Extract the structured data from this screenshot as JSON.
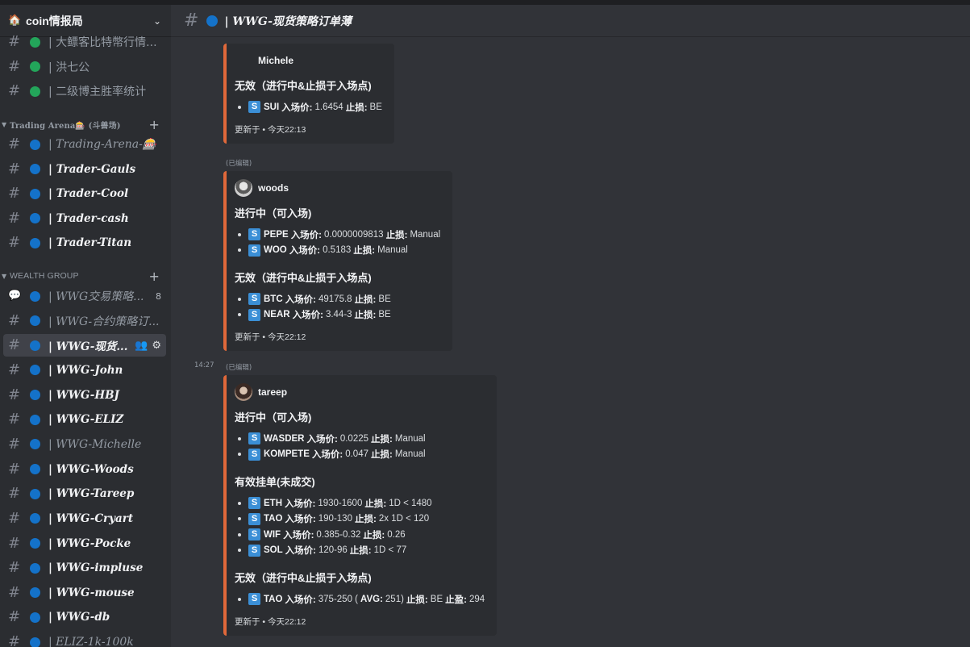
{
  "server": {
    "icon": "house-emoji-icon",
    "name": "coin情报局"
  },
  "top_channels": [
    {
      "name": "| 大鳔客比特幣行情...",
      "dot": "green"
    },
    {
      "name": "| 洪七公",
      "dot": "green"
    },
    {
      "name": "| 二级博主胜率统计",
      "dot": "green"
    }
  ],
  "category_trading": "Trading Arena🎰 (斗兽场)",
  "trading_channels": [
    {
      "name": "| Trading-Arena-🎰",
      "dot": "blue",
      "style": "serif"
    },
    {
      "name": "| Trader-Gauls",
      "dot": "blue",
      "style": "bold"
    },
    {
      "name": "| Trader-Cool",
      "dot": "blue",
      "style": "bold"
    },
    {
      "name": "| Trader-cash",
      "dot": "blue",
      "style": "bold"
    },
    {
      "name": "| Trader-Titan",
      "dot": "blue",
      "style": "bold"
    }
  ],
  "category_wealth": "WEALTH GROUP",
  "wealth_channels": [
    {
      "name": "| WWG交易策略...",
      "dot": "blue",
      "style": "serif",
      "badge": "8",
      "icon": "forum-icon"
    },
    {
      "name": "| WWG-合约策略订...",
      "dot": "blue",
      "style": "serif"
    },
    {
      "name": "| WWG-现货...",
      "dot": "blue",
      "style": "active"
    },
    {
      "name": "| WWG-John",
      "dot": "blue",
      "style": "bold"
    },
    {
      "name": "| WWG-HBJ",
      "dot": "blue",
      "style": "bold"
    },
    {
      "name": "| WWG-ELIZ",
      "dot": "blue",
      "style": "bold"
    },
    {
      "name": "| WWG-Michelle",
      "dot": "blue",
      "style": "serif"
    },
    {
      "name": "| WWG-Woods",
      "dot": "blue",
      "style": "bold"
    },
    {
      "name": "| WWG-Tareep",
      "dot": "blue",
      "style": "bold"
    },
    {
      "name": "| WWG-Cryart",
      "dot": "blue",
      "style": "bold"
    },
    {
      "name": "| WWG-Pocke",
      "dot": "blue",
      "style": "bold"
    },
    {
      "name": "| WWG-impluse",
      "dot": "blue",
      "style": "bold"
    },
    {
      "name": "| WWG-mouse",
      "dot": "blue",
      "style": "bold"
    },
    {
      "name": "| WWG-db",
      "dot": "blue",
      "style": "bold"
    },
    {
      "name": "| ELIZ-1k-100k",
      "dot": "blue",
      "style": "serif"
    }
  ],
  "header": {
    "title": "| WWG-现货策略订单薄"
  },
  "messages": [
    {
      "author": "Michele",
      "sections": [
        {
          "title": "无效（进行中&止损于入场点)",
          "items": [
            {
              "coin": "SUI",
              "entry_label": "入场价:",
              "entry": "1.6454",
              "stop_label": "止损:",
              "stop": "BE"
            }
          ]
        }
      ],
      "footer": "更新于 • 今天22:13"
    },
    {
      "edited": "(已编辑)",
      "author": "woods",
      "sections": [
        {
          "title": "进行中（可入场)",
          "items": [
            {
              "coin": "PEPE",
              "entry_label": "入场价:",
              "entry": "0.0000009813",
              "stop_label": "止损:",
              "stop": "Manual"
            },
            {
              "coin": "WOO",
              "entry_label": "入场价:",
              "entry": "0.5183",
              "stop_label": "止损:",
              "stop": "Manual"
            }
          ]
        },
        {
          "title": "无效（进行中&止损于入场点)",
          "items": [
            {
              "coin": "BTC",
              "entry_label": "入场价:",
              "entry": "49175.8",
              "stop_label": "止损:",
              "stop": "BE"
            },
            {
              "coin": "NEAR",
              "entry_label": "入场价:",
              "entry": "3.44-3",
              "stop_label": "止损:",
              "stop": "BE"
            }
          ]
        }
      ],
      "footer": "更新于 • 今天22:12"
    },
    {
      "timestamp": "14:27",
      "edited": "(已编辑)",
      "author": "tareep",
      "sections": [
        {
          "title": "进行中（可入场)",
          "items": [
            {
              "coin": "WASDER",
              "entry_label": "入场价:",
              "entry": "0.0225",
              "stop_label": "止损:",
              "stop": "Manual"
            },
            {
              "coin": "KOMPETE",
              "entry_label": "入场价:",
              "entry": "0.047",
              "stop_label": "止损:",
              "stop": "Manual"
            }
          ]
        },
        {
          "title": "有效挂单(未成交)",
          "items": [
            {
              "coin": "ETH",
              "entry_label": "入场价:",
              "entry": "1930-1600",
              "stop_label": "止损:",
              "stop": "1D < 1480"
            },
            {
              "coin": "TAO",
              "entry_label": "入场价:",
              "entry": "190-130",
              "stop_label": "止损:",
              "stop": "2x 1D < 120"
            },
            {
              "coin": "WIF",
              "entry_label": "入场价:",
              "entry": "0.385-0.32",
              "stop_label": "止损:",
              "stop": "0.26"
            },
            {
              "coin": "SOL",
              "entry_label": "入场价:",
              "entry": "120-96",
              "stop_label": "止损:",
              "stop": "1D < 77"
            }
          ]
        },
        {
          "title": "无效（进行中&止损于入场点)",
          "items": [
            {
              "coin": "TAO",
              "entry_label": "入场价:",
              "entry": "375-250 (",
              "avg_label": "AVG:",
              "avg": "251)",
              "stop_label": "止损:",
              "stop": "BE",
              "tp_label": "止盈:",
              "tp": "294"
            }
          ]
        }
      ],
      "footer": "更新于 • 今天22:12"
    }
  ],
  "colors": {
    "accent": "#e0683a",
    "dot_blue": "#1472c9",
    "dot_green": "#23a55a",
    "coin_badge": "#3b8fd6"
  }
}
